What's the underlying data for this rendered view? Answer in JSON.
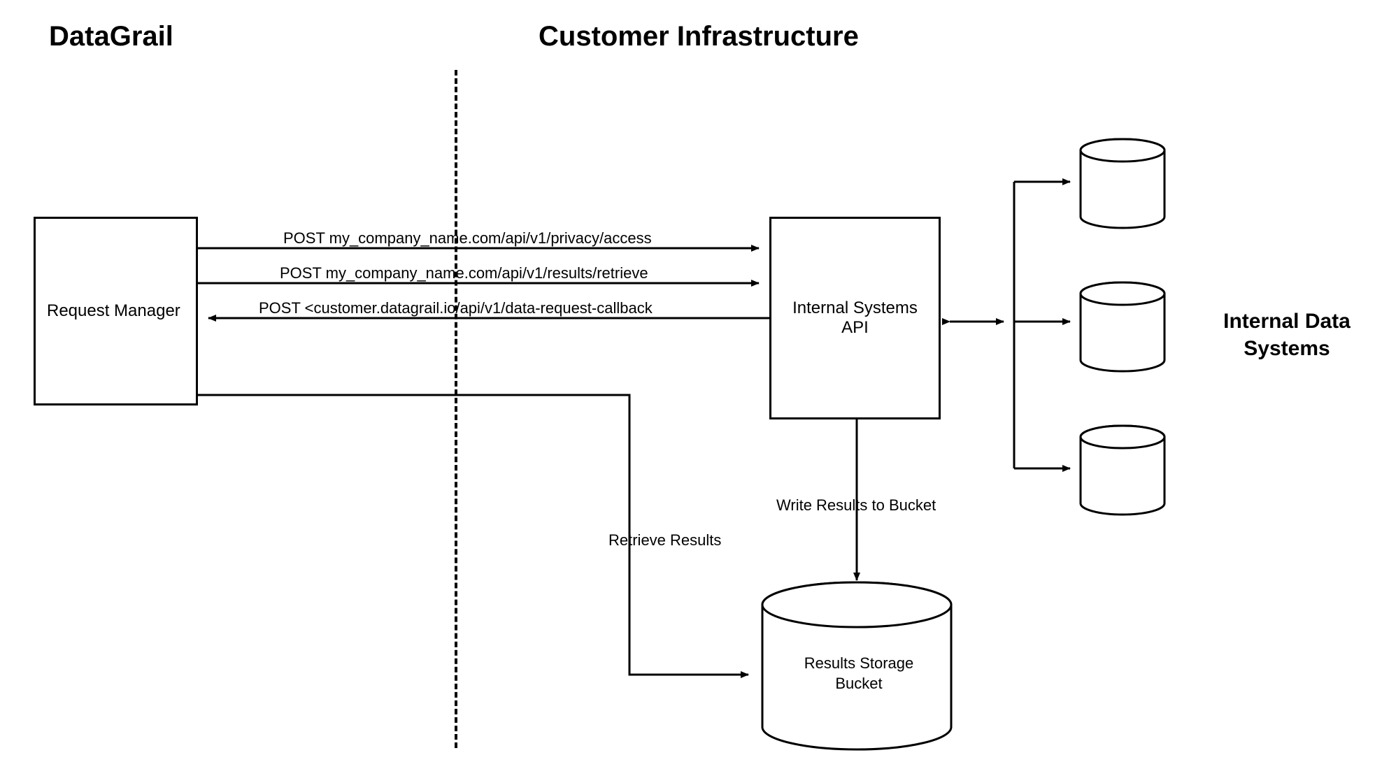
{
  "headings": {
    "left": "DataGrail",
    "right": "Customer Infrastructure"
  },
  "nodes": {
    "request_manager": "Request Manager",
    "internal_api_line1": "Internal Systems",
    "internal_api_line2": "API",
    "storage_bucket_line1": "Results Storage",
    "storage_bucket_line2": "Bucket",
    "internal_data_line1": "Internal Data",
    "internal_data_line2": "Systems"
  },
  "edges": {
    "api_access": "POST my_company_name.com/api/v1/privacy/access",
    "api_retrieve": "POST my_company_name.com/api/v1/results/retrieve",
    "api_callback": "POST <customer.datagrail.io/api/v1/data-request-callback",
    "write_results": "Write Results to Bucket",
    "retrieve_results": "Retrieve Results"
  }
}
